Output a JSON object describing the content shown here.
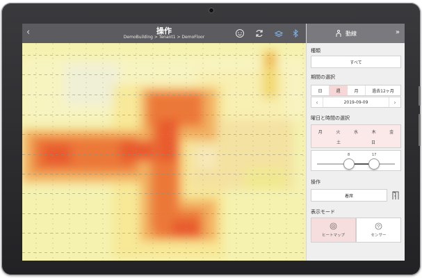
{
  "topbar": {
    "title": "操作",
    "breadcrumb": "DemoBuilding > Tenant1 > DemoFloor",
    "icons": [
      "chevron-left-icon",
      "smiley-icon",
      "refresh-icon",
      "stack-icon",
      "bluetooth-icon"
    ]
  },
  "panel": {
    "analysis_label": "動線",
    "category_label": "種類",
    "category_value": "すべて",
    "period_label": "期間の選択",
    "period_options": [
      {
        "label": "日",
        "selected": false
      },
      {
        "label": "週",
        "selected": true
      },
      {
        "label": "月",
        "selected": false
      },
      {
        "label": "過去12ヶ月",
        "selected": false
      }
    ],
    "date_value": "2019-09-09",
    "dayhour_label": "曜日と時間の選択",
    "days_row1": [
      "月",
      "火",
      "水",
      "木",
      "金"
    ],
    "days_row2": [
      "土",
      "日"
    ],
    "hour_start": "8",
    "hour_end": "17",
    "operation_label": "操作",
    "operation_value": "着席",
    "mode_label": "表示モード",
    "mode_heatmap": "ヒートマップ",
    "mode_sensor": "センサー"
  },
  "colors": {
    "topbar": "#5c5c60",
    "panel_header": "#7a7a7e",
    "selected_pink": "#f6d6d6",
    "heat_low": "#f6f3a8",
    "heat_high": "#e8502a"
  }
}
